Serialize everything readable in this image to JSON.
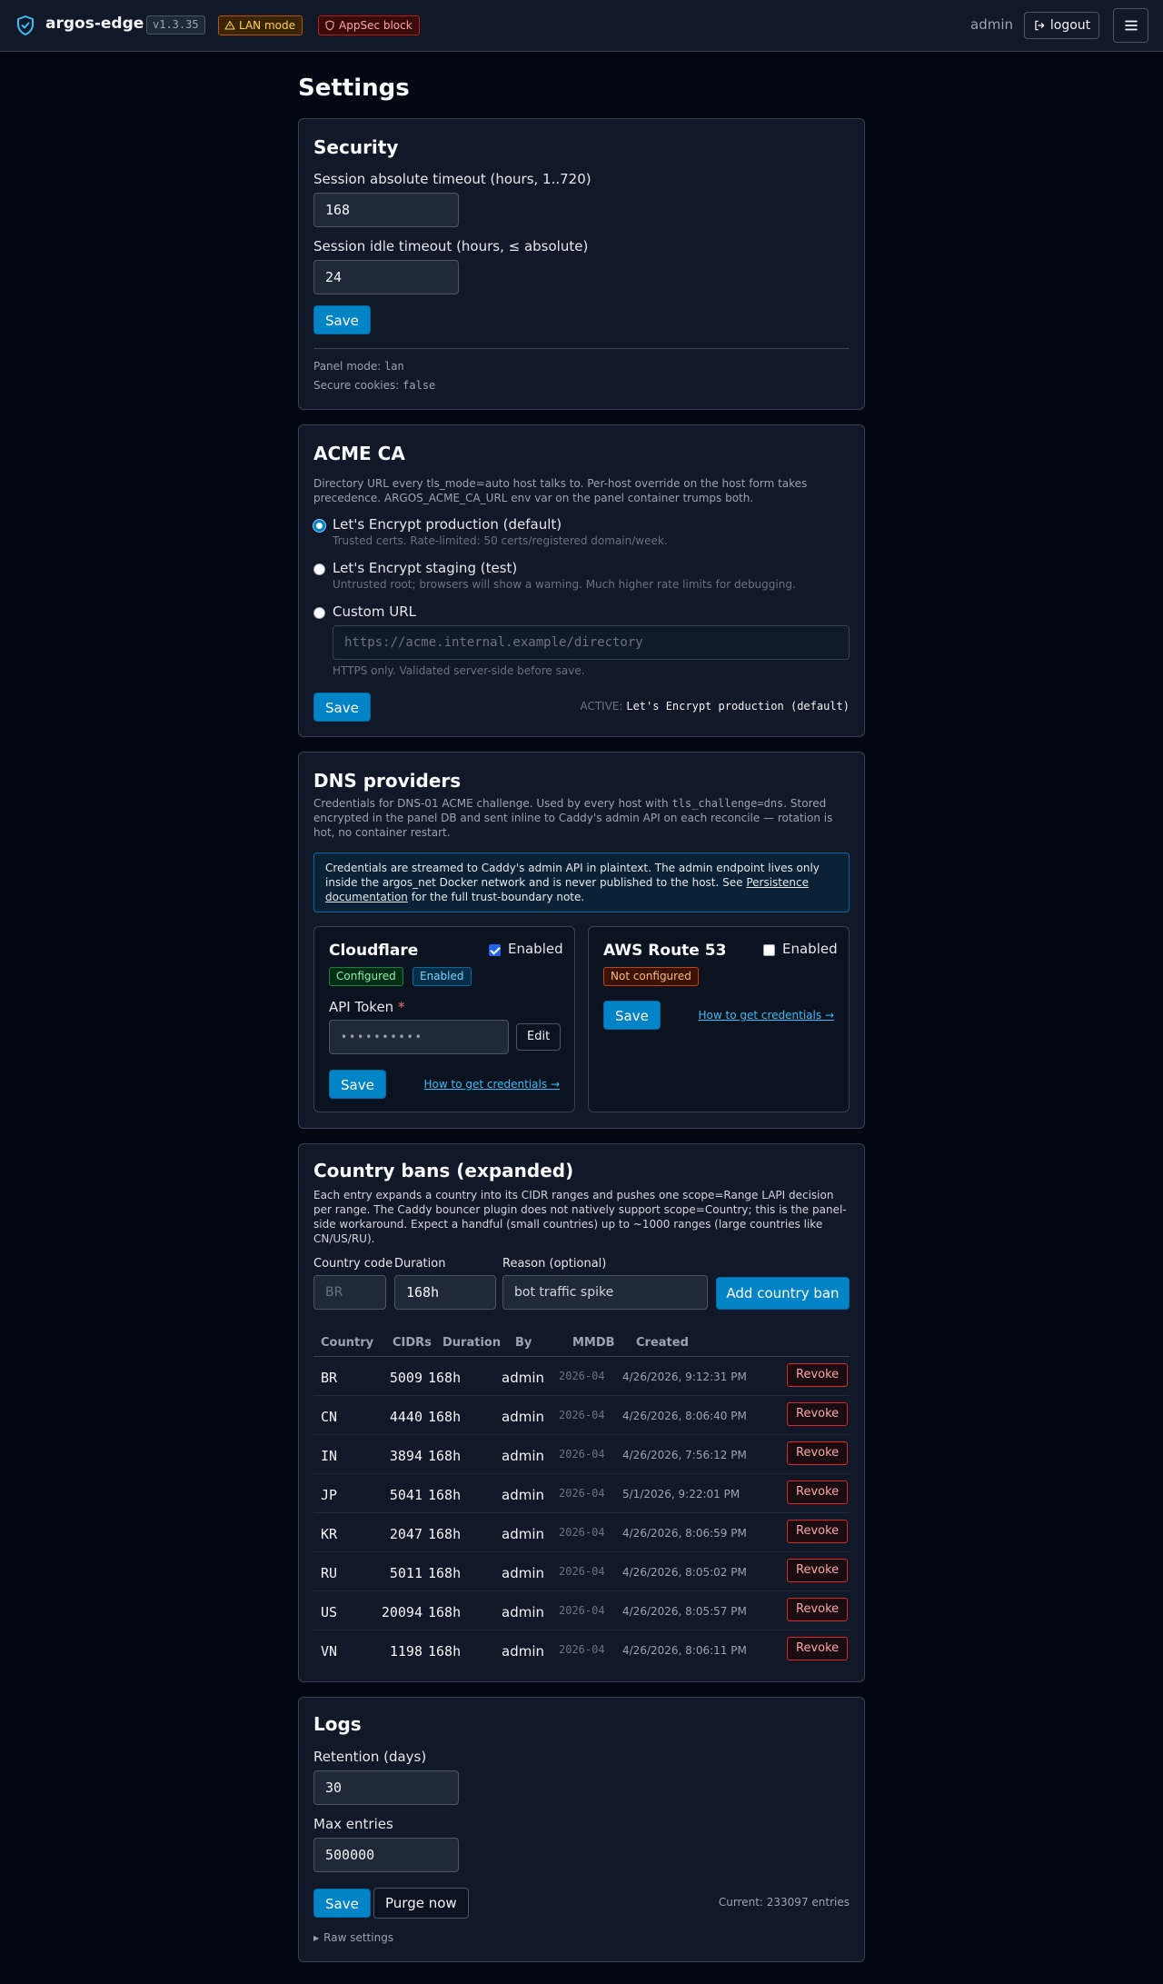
{
  "header": {
    "brand": "argos-edge",
    "version": "v1.3.35",
    "lan_badge": "LAN mode",
    "appsec_badge": "AppSec block",
    "user": "admin",
    "logout_label": "logout"
  },
  "page_title": "Settings",
  "security": {
    "title": "Security",
    "absolute_label": "Session absolute timeout (hours, 1..720)",
    "absolute_value": "168",
    "idle_label": "Session idle timeout (hours, ≤ absolute)",
    "idle_value": "24",
    "save_label": "Save",
    "panel_mode_label": "Panel mode: ",
    "panel_mode_value": "lan",
    "secure_cookies_label": "Secure cookies: ",
    "secure_cookies_value": "false"
  },
  "acme": {
    "title": "ACME CA",
    "description": "Directory URL every tls_mode=auto host talks to. Per-host override on the host form takes precedence. ARGOS_ACME_CA_URL env var on the panel container trumps both.",
    "options": [
      {
        "label": "Let's Encrypt production (default)",
        "hint": "Trusted certs. Rate-limited: 50 certs/registered domain/week.",
        "selected": true
      },
      {
        "label": "Let's Encrypt staging (test)",
        "hint": "Untrusted root; browsers will show a warning. Much higher rate limits for debugging.",
        "selected": false
      },
      {
        "label": "Custom URL",
        "hint": "",
        "selected": false
      }
    ],
    "custom_placeholder": "https://acme.internal.example/directory",
    "custom_hint": "HTTPS only. Validated server-side before save.",
    "save_label": "Save",
    "active_label": "ACTIVE: ",
    "active_value": "Let's Encrypt production (default)"
  },
  "dns": {
    "title": "DNS providers",
    "description_part1": "Credentials for DNS-01 ACME challenge. Used by every host with ",
    "description_code": "tls_challenge=dns",
    "description_part2": ". Stored encrypted in the panel DB and sent inline to Caddy's admin API on each reconcile — rotation is hot, no container restart.",
    "notice_text": "Credentials are streamed to Caddy's admin API in plaintext. The admin endpoint lives only inside the argos_net Docker network and is never published to the host. See ",
    "notice_link": "Persistence documentation",
    "notice_tail": " for the full trust-boundary note.",
    "providers": [
      {
        "name": "Cloudflare",
        "enabled_label": "Enabled",
        "enabled": true,
        "badges": [
          "Configured",
          "Enabled"
        ],
        "field_label": "API Token",
        "required_mark": "*",
        "field_value": "••••••••••",
        "edit_label": "Edit",
        "save_label": "Save",
        "help_link": "How to get credentials →"
      },
      {
        "name": "AWS Route 53",
        "enabled_label": "Enabled",
        "enabled": false,
        "badges": [
          "Not configured"
        ],
        "save_label": "Save",
        "help_link": "How to get credentials →"
      }
    ]
  },
  "country_bans": {
    "title": "Country bans (expanded)",
    "description": "Each entry expands a country into its CIDR ranges and pushes one scope=Range LAPI decision per range. The Caddy bouncer plugin does not natively support scope=Country; this is the panel-side workaround. Expect a handful (small countries) up to ~1000 ranges (large countries like CN/US/RU).",
    "country_code_label": "Country code",
    "country_code_placeholder": "BR",
    "duration_label": "Duration",
    "duration_value": "168h",
    "reason_label": "Reason (optional)",
    "reason_value": "bot traffic spike",
    "add_label": "Add country ban",
    "columns": [
      "Country",
      "CIDRs",
      "Duration",
      "By",
      "MMDB",
      "Created"
    ],
    "revoke_label": "Revoke",
    "rows": [
      {
        "country": "BR",
        "cidrs": "5009",
        "duration": "168h",
        "by": "admin",
        "mmdb": "2026-04",
        "created": "4/26/2026, 9:12:31 PM"
      },
      {
        "country": "CN",
        "cidrs": "4440",
        "duration": "168h",
        "by": "admin",
        "mmdb": "2026-04",
        "created": "4/26/2026, 8:06:40 PM"
      },
      {
        "country": "IN",
        "cidrs": "3894",
        "duration": "168h",
        "by": "admin",
        "mmdb": "2026-04",
        "created": "4/26/2026, 7:56:12 PM"
      },
      {
        "country": "JP",
        "cidrs": "5041",
        "duration": "168h",
        "by": "admin",
        "mmdb": "2026-04",
        "created": "5/1/2026, 9:22:01 PM"
      },
      {
        "country": "KR",
        "cidrs": "2047",
        "duration": "168h",
        "by": "admin",
        "mmdb": "2026-04",
        "created": "4/26/2026, 8:06:59 PM"
      },
      {
        "country": "RU",
        "cidrs": "5011",
        "duration": "168h",
        "by": "admin",
        "mmdb": "2026-04",
        "created": "4/26/2026, 8:05:02 PM"
      },
      {
        "country": "US",
        "cidrs": "20094",
        "duration": "168h",
        "by": "admin",
        "mmdb": "2026-04",
        "created": "4/26/2026, 8:05:57 PM"
      },
      {
        "country": "VN",
        "cidrs": "1198",
        "duration": "168h",
        "by": "admin",
        "mmdb": "2026-04",
        "created": "4/26/2026, 8:06:11 PM"
      }
    ]
  },
  "logs": {
    "title": "Logs",
    "retention_label": "Retention (days)",
    "retention_value": "30",
    "max_label": "Max entries",
    "max_value": "500000",
    "save_label": "Save",
    "purge_label": "Purge now",
    "current_text": "Current: 233097 entries",
    "raw_settings": "Raw settings"
  },
  "colors": {
    "accent": "#0284c7",
    "background": "#030712",
    "card": "#111827"
  },
  "icons": [
    "shield-check-icon",
    "warning-icon",
    "shield-icon",
    "logout-icon",
    "hamburger-icon",
    "caret-right-icon"
  ]
}
